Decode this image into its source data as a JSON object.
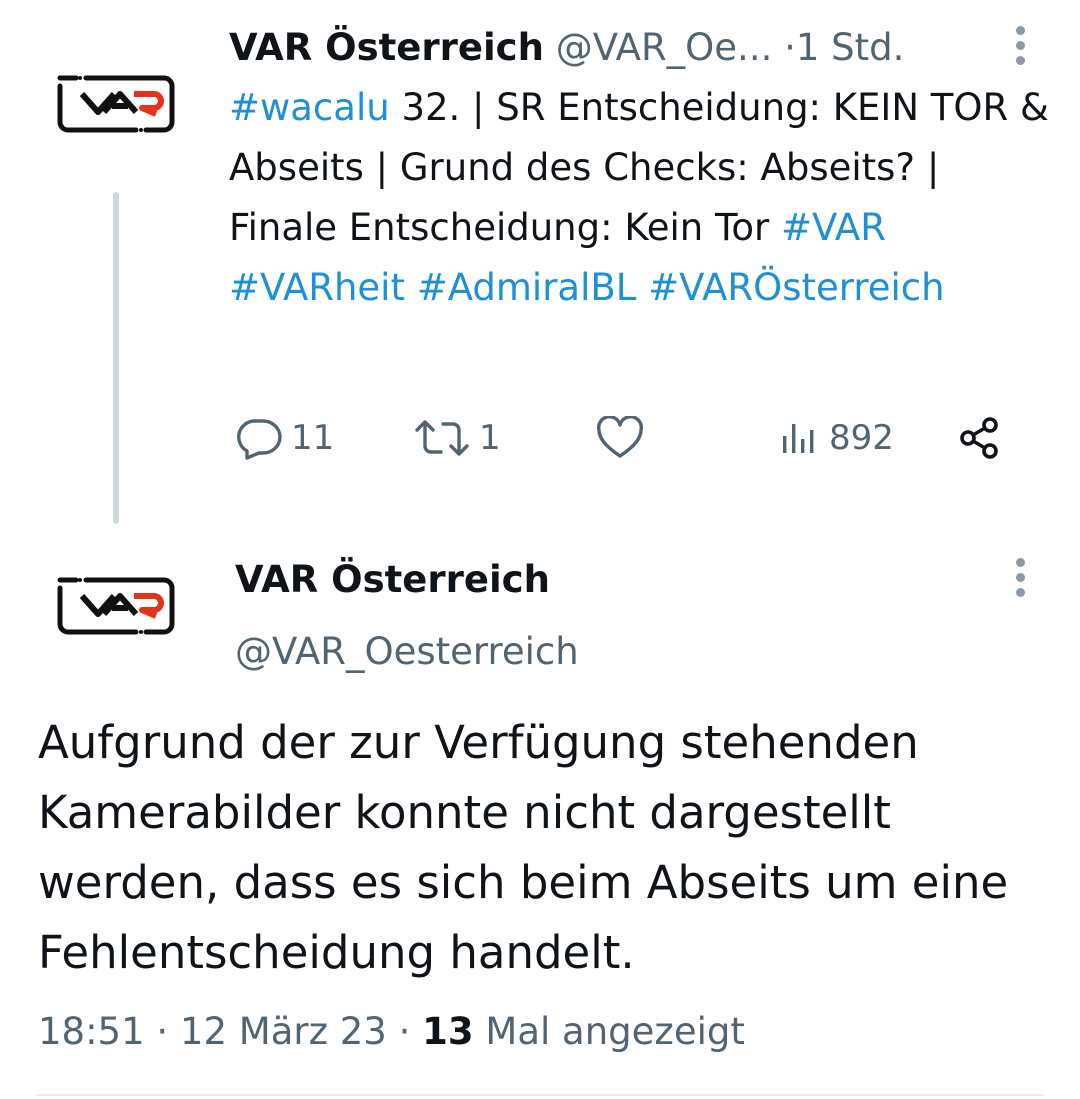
{
  "tweet1": {
    "author_name": "VAR Österreich",
    "author_handle": "@VAR_Oe...",
    "separator": "·",
    "time": "1 Std.",
    "text": {
      "hashtag_wacalu": "#wacalu",
      "main": " 32. | SR Entscheidung: KEIN TOR & Abseits | Grund des Checks: Abseits? | Finale Entscheidung: Kein Tor ",
      "hashtags": [
        "#VAR",
        "#VARheit",
        "#AdmiralBL",
        "#VARÖsterreich"
      ]
    },
    "actions": {
      "reply_count": "11",
      "retweet_count": "1",
      "like_count": "",
      "views_count": "892"
    }
  },
  "tweet2": {
    "author_name": "VAR Österreich",
    "author_handle": "@VAR_Oesterreich",
    "body": "Aufgrund der zur Verfügung stehenden Kamerabilder konnte nicht dargestellt werden, dass es sich beim Abseits um eine Fehlentscheidung handelt.",
    "meta": {
      "time": "18:51",
      "dot1": " · ",
      "date": "12 März 23",
      "dot2": " · ",
      "views_number": "13",
      "views_label": " Mal angezeigt"
    }
  },
  "avatar": {
    "logo_text": "VAR",
    "logo_colors": {
      "frame": "#111111",
      "accent": "#e5321c"
    }
  },
  "icons": {
    "reply": "reply-icon",
    "retweet": "retweet-icon",
    "like": "heart-icon",
    "views": "views-icon",
    "share": "share-icon",
    "more": "more-icon"
  },
  "colors": {
    "link": "#1f8fd8",
    "secondary_text": "#536471",
    "primary_text": "#0f1419",
    "thread_line": "#cfd9de"
  }
}
